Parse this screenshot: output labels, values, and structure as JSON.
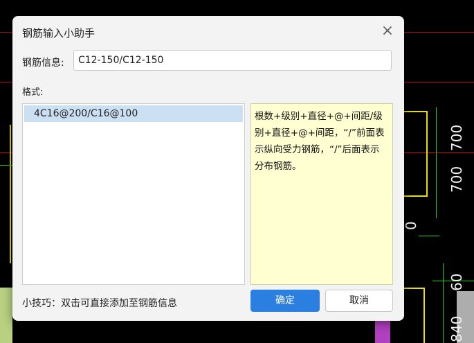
{
  "background": {
    "dimension_labels": [
      "700",
      "700",
      "60",
      "840",
      "0"
    ]
  },
  "dialog": {
    "title": "钢筋输入小助手",
    "close_symbol": "×",
    "info_label": "钢筋信息:",
    "info_value": "C12-150/C12-150",
    "format_label": "格式:",
    "format_items": [
      "4C16@200/C16@100"
    ],
    "help_text": "根数+级别+直径+@+间距/级别+直径+@+间距，“/”前面表示纵向受力钢筋，“/”后面表示分布钢筋。",
    "tip": "小技巧：双击可直接添加至钢筋信息",
    "ok_label": "确定",
    "cancel_label": "取消"
  },
  "colors": {
    "primary": "#2b7fe0",
    "help_bg": "#ffffd2",
    "selected_item": "#cce0f4"
  }
}
